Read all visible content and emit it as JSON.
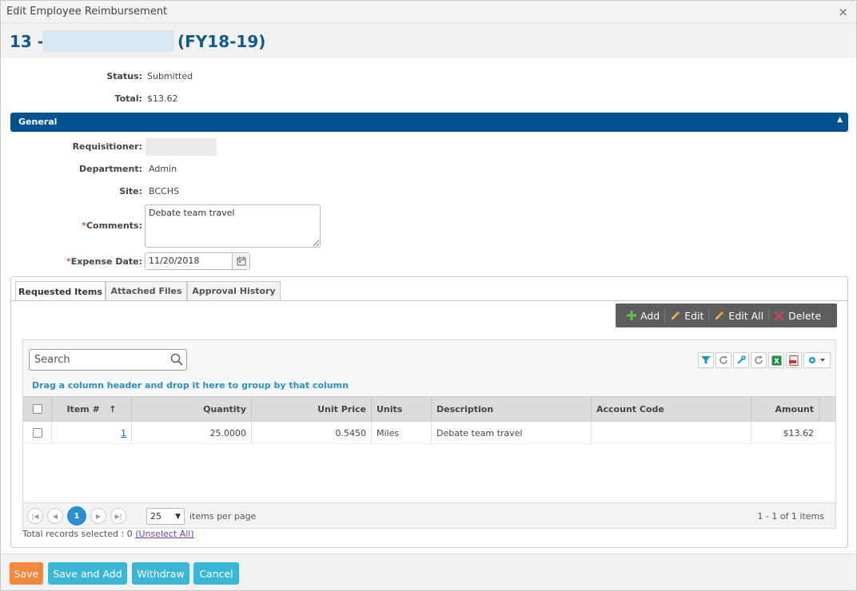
{
  "window": {
    "title": "Edit Employee Reimbursement",
    "close_glyph": "×"
  },
  "heading": {
    "prefix": "13 -",
    "fiscal_year": "(FY18-19)"
  },
  "summary": {
    "status_label": "Status:",
    "status_value": "Submitted",
    "total_label": "Total:",
    "total_value": "$13.62"
  },
  "general": {
    "title": "General",
    "requisitioner_label": "Requisitioner:",
    "department_label": "Department:",
    "department_value": "Admin",
    "site_label": "Site:",
    "site_value": "BCCHS",
    "comments_label": "Comments:",
    "comments_value": "Debate team travel",
    "expense_date_label": "Expense Date:",
    "expense_date_value": "11/20/2018",
    "required_marker": "*"
  },
  "tabs": [
    "Requested Items",
    "Attached Files",
    "Approval History"
  ],
  "toolbar": {
    "add": "Add",
    "edit": "Edit",
    "edit_all": "Edit All",
    "delete": "Delete"
  },
  "grid": {
    "search_placeholder": "Search",
    "group_hint": "Drag a column header and drop it here to group by that column",
    "columns": [
      "Item #",
      "Quantity",
      "Unit Price",
      "Units",
      "Description",
      "Account Code",
      "Amount"
    ],
    "sort_indicator": "↑",
    "rows": [
      {
        "item": "1",
        "quantity": "25.0000",
        "unit_price": "0.5450",
        "units": "Miles",
        "description": "Debate team travel",
        "account_code": "",
        "amount": "$13.62"
      }
    ],
    "pager": {
      "current_page": "1",
      "page_size": "25",
      "per_page_label": "items per page",
      "info": "1 - 1 of 1 items"
    },
    "selected_info": "Total records selected : 0",
    "unselect_all": "(Unselect All)"
  },
  "footer": {
    "save": "Save",
    "save_and_add": "Save and Add",
    "withdraw": "Withdraw",
    "cancel": "Cancel"
  },
  "colors": {
    "header_blue": "#005390",
    "title_blue": "#125a8c",
    "save_orange": "#f0883e",
    "action_teal": "#3bb6d6",
    "pager_blue": "#2a8fd1"
  },
  "icons": [
    "close-icon",
    "collapse-caret-icon",
    "calendar-icon",
    "plus-icon",
    "pencil-icon",
    "delete-x-icon",
    "search-icon",
    "filter-icon",
    "refresh-icon",
    "wrench-icon",
    "excel-icon",
    "pdf-icon",
    "gear-icon",
    "sort-asc-icon",
    "first-page-icon",
    "prev-page-icon",
    "next-page-icon",
    "last-page-icon"
  ]
}
